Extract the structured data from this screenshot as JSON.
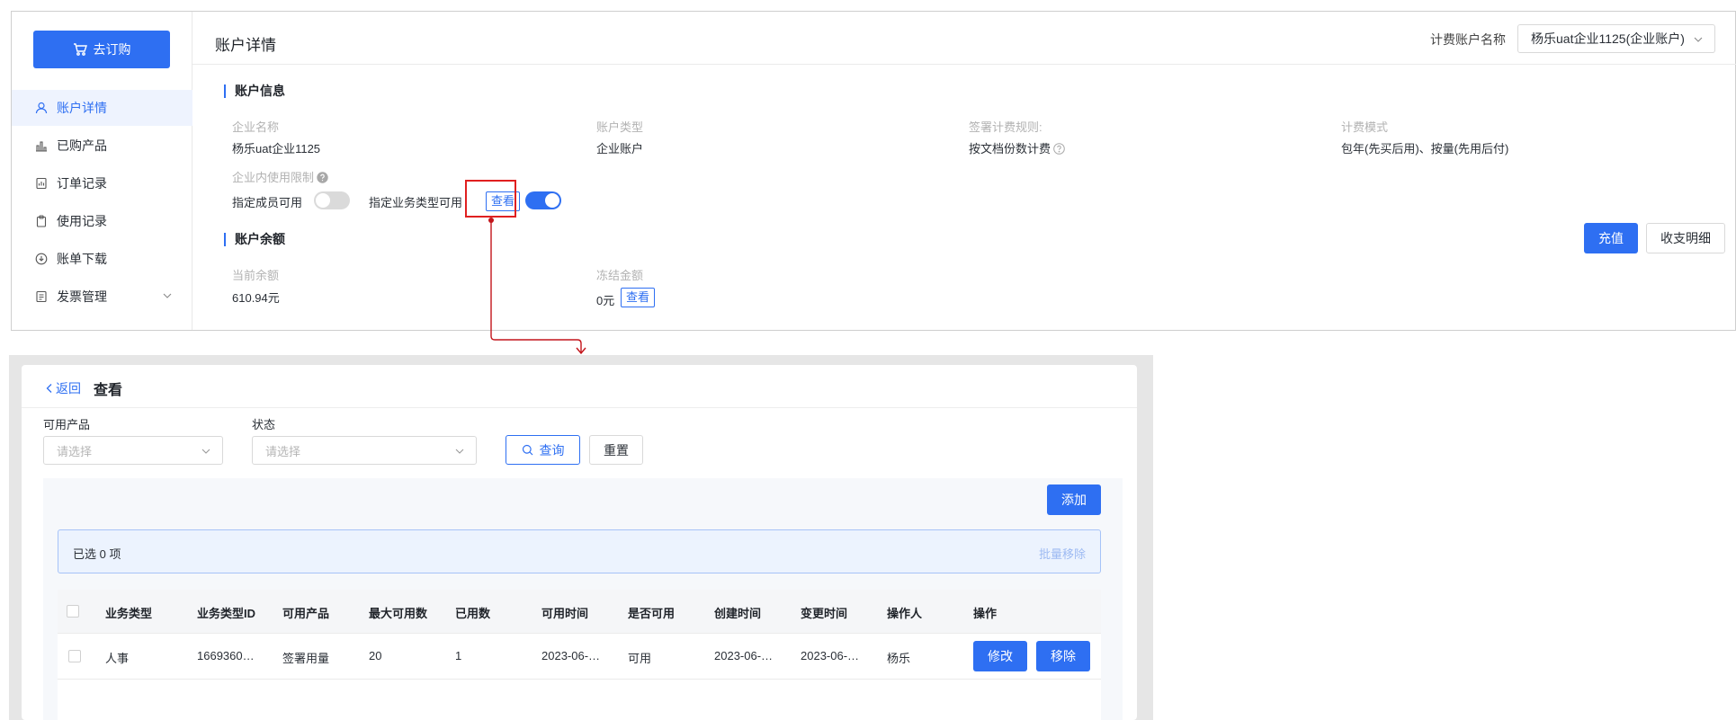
{
  "sidebar": {
    "order_button": "去订购",
    "items": [
      {
        "label": "账户详情",
        "icon": "user-icon",
        "active": true
      },
      {
        "label": "已购产品",
        "icon": "bar-chart-icon"
      },
      {
        "label": "订单记录",
        "icon": "order-icon"
      },
      {
        "label": "使用记录",
        "icon": "clipboard-icon"
      },
      {
        "label": "账单下载",
        "icon": "download-icon"
      },
      {
        "label": "发票管理",
        "icon": "invoice-icon",
        "expandable": true
      }
    ]
  },
  "header": {
    "title": "账户详情",
    "billing_label": "计费账户名称",
    "billing_value": "杨乐uat企业1125(企业账户)"
  },
  "account_info": {
    "section_title": "账户信息",
    "company_label": "企业名称",
    "company_value": "杨乐uat企业1125",
    "type_label": "账户类型",
    "type_value": "企业账户",
    "rule_label": "签署计费规则:",
    "rule_value": "按文档份数计费",
    "mode_label": "计费模式",
    "mode_value": "包年(先买后用)、按量(先用后付)",
    "limit_label": "企业内使用限制",
    "member_label": "指定成员可用",
    "member_enabled": false,
    "biz_type_label": "指定业务类型可用",
    "biz_type_enabled": true,
    "view_button": "查看"
  },
  "balance": {
    "section_title": "账户余额",
    "current_label": "当前余额",
    "current_value": "610.94元",
    "frozen_label": "冻结金额",
    "frozen_value": "0元",
    "view_button": "查看",
    "recharge_button": "充值",
    "detail_button": "收支明细"
  },
  "detail_page": {
    "back_label": "返回",
    "title": "查看",
    "filters": {
      "product_label": "可用产品",
      "product_placeholder": "请选择",
      "status_label": "状态",
      "status_placeholder": "请选择",
      "query_button": "查询",
      "reset_button": "重置"
    },
    "add_button": "添加",
    "selected_text": "已选 0 项",
    "batch_remove": "批量移除",
    "columns": [
      "业务类型",
      "业务类型ID",
      "可用产品",
      "最大可用数",
      "已用数",
      "可用时间",
      "是否可用",
      "创建时间",
      "变更时间",
      "操作人",
      "操作"
    ],
    "rows": [
      {
        "cells": [
          "人事",
          "1669360…",
          "签署用量",
          "20",
          "1",
          "2023-06-…",
          "可用",
          "2023-06-…",
          "2023-06-…",
          "杨乐"
        ],
        "edit_button": "修改",
        "remove_button": "移除"
      }
    ]
  },
  "colors": {
    "primary": "#2e6ff2",
    "highlight": "#e02020",
    "connector": "#c3151b"
  }
}
